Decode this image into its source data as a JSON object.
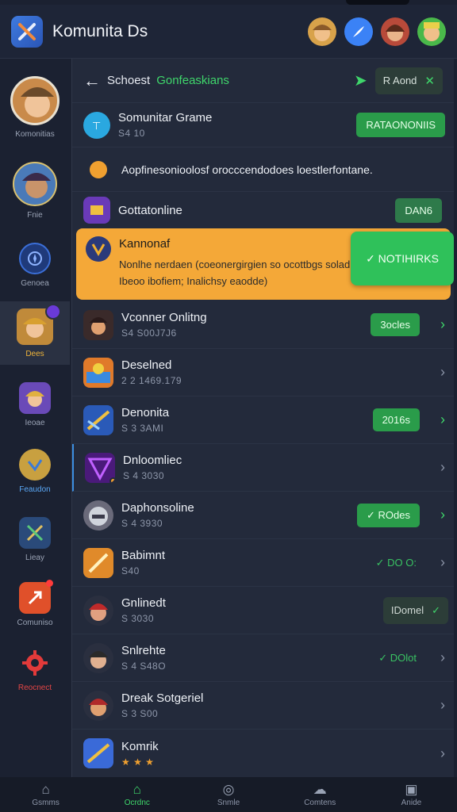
{
  "header": {
    "title": "Komunita Ds"
  },
  "sidebar": {
    "items": [
      {
        "label": "Komonitias"
      },
      {
        "label": "Fnie"
      },
      {
        "label": "Genoea"
      },
      {
        "label": "Dees"
      },
      {
        "label": "Ieoae"
      },
      {
        "label": "Feaudon"
      },
      {
        "label": "Lieay"
      },
      {
        "label": "Comuniso"
      },
      {
        "label": "Reocnect"
      }
    ]
  },
  "panel": {
    "crumb": "Schoest",
    "crumb_accent": "Gonfeaskians",
    "add_chip": "R Aond",
    "rows": [
      {
        "name": "Somunitar Grame",
        "meta": "S4 10",
        "action": "RATAONONIIS"
      },
      {
        "name": "Aopfinesonioolosf orocccendodoes loestlerfontane."
      },
      {
        "name": "Gottatonline",
        "action": "DAN6"
      },
      {
        "name": "Vconner Onlitng",
        "meta": "S4 S00J7J6",
        "action": "3ocles"
      },
      {
        "name": "Deselned",
        "meta": "2 2 1469.179"
      },
      {
        "name": "Denonita",
        "meta": "S 3 3AMI",
        "action": "2016s"
      },
      {
        "name": "Dnloomliec",
        "meta": "S 4 3030"
      },
      {
        "name": "Daphonsoline",
        "meta": "S 4 3930",
        "action": "✓ ROdes"
      },
      {
        "name": "Babimnt",
        "meta": "S40",
        "action": "✓ DO O:"
      },
      {
        "name": "Gnlinedt",
        "meta": "S 3030",
        "action": "IDomel"
      },
      {
        "name": "Snlrehte",
        "meta": "S 4 S48O",
        "action": "✓ DOlot"
      },
      {
        "name": "Dreak Sotgeriel",
        "meta": "S 3 S00"
      },
      {
        "name": "Komrik"
      }
    ],
    "highlight": {
      "title": "Kannonaf",
      "line1": "Nonlhe nerdaen (coeonergirgien so ocottbgs solad;",
      "line2": "Ibeoo ibofiem; Inalichsy eaodde)",
      "button": "✓ NOTIHIRKS"
    }
  },
  "bottomnav": {
    "items": [
      {
        "label": "Gsmms"
      },
      {
        "label": "Ocrdnc"
      },
      {
        "label": "Snmle"
      },
      {
        "label": "Comtens"
      },
      {
        "label": "Anide"
      }
    ]
  },
  "colors": {
    "accent": "#3fd66b",
    "highlight": "#f4a838",
    "background": "#1b2131"
  },
  "icons": [
    "tools-icon",
    "paper-plane-icon",
    "chevron-right-icon",
    "back-arrow-icon",
    "home-icon"
  ]
}
